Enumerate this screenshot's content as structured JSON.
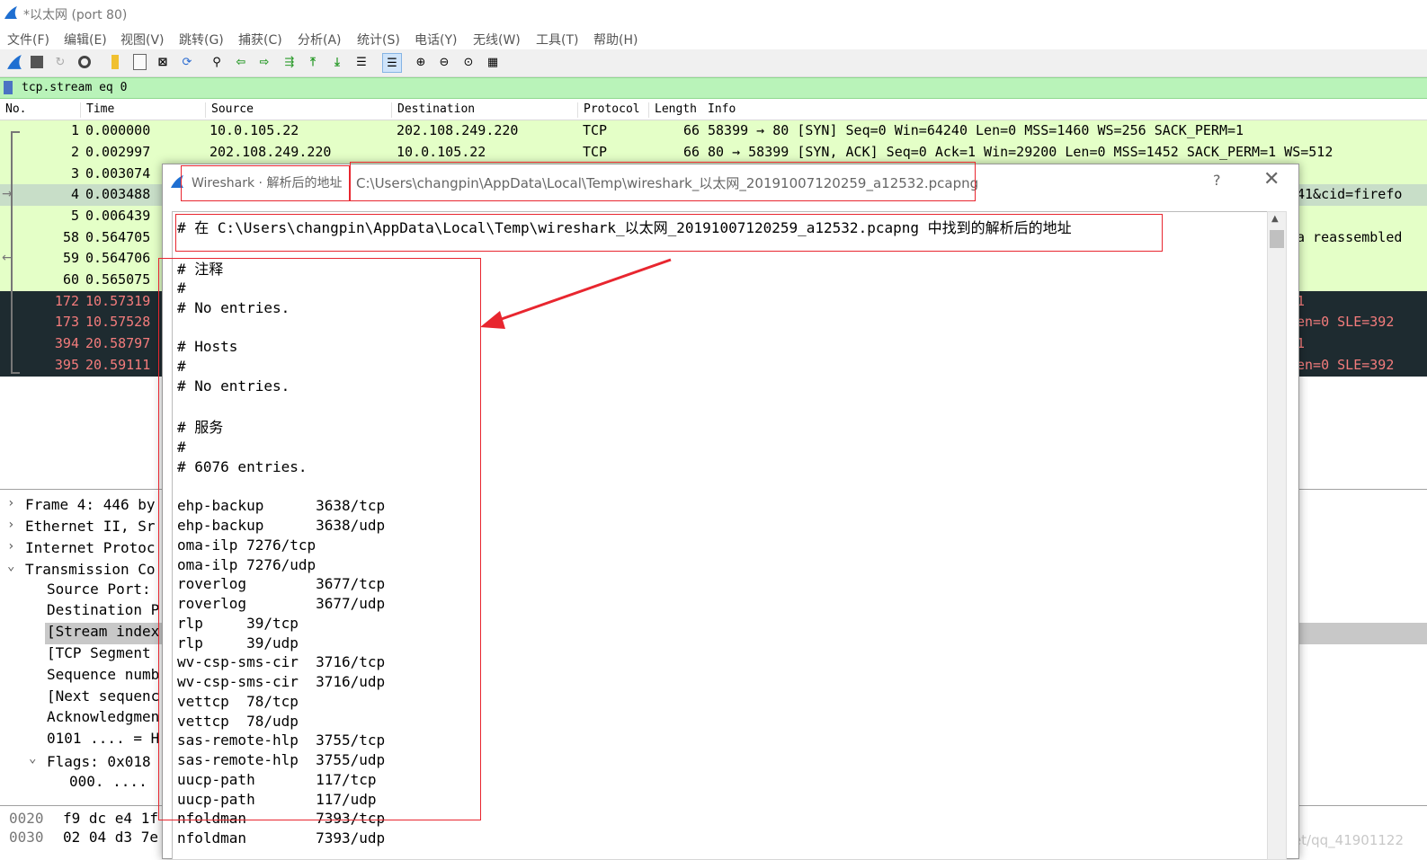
{
  "window": {
    "title": "*以太网 (port 80)"
  },
  "menu": [
    "文件(F)",
    "编辑(E)",
    "视图(V)",
    "跳转(G)",
    "捕获(C)",
    "分析(A)",
    "统计(S)",
    "电话(Y)",
    "无线(W)",
    "工具(T)",
    "帮助(H)"
  ],
  "toolbar": {
    "icons": [
      "shark-fin-start-icon",
      "stop-square-icon",
      "restart-icon",
      "capture-options-icon",
      "open-folder-icon",
      "save-file-icon",
      "close-file-icon",
      "reload-icon",
      "find-packet-icon",
      "go-back-icon",
      "go-forward-icon",
      "go-to-packet-icon",
      "first-packet-icon",
      "last-packet-icon",
      "autoscroll-icon",
      "colorize-icon",
      "zoom-in-icon",
      "zoom-out-icon",
      "normal-size-icon",
      "resize-columns-icon"
    ]
  },
  "filter": {
    "value": "tcp.stream eq 0"
  },
  "packet_list": {
    "columns": [
      "No.",
      "Time",
      "Source",
      "Destination",
      "Protocol",
      "Length",
      "Info"
    ],
    "rows": [
      {
        "no": "1",
        "time": "0.000000",
        "src": "10.0.105.22",
        "dst": "202.108.249.220",
        "proto": "TCP",
        "len": "66",
        "info": "58399 → 80 [SYN] Seq=0 Win=64240 Len=0 MSS=1460 WS=256 SACK_PERM=1",
        "style": "green"
      },
      {
        "no": "2",
        "time": "0.002997",
        "src": "202.108.249.220",
        "dst": "10.0.105.22",
        "proto": "TCP",
        "len": "66",
        "info": "80 → 58399 [SYN, ACK] Seq=0 Ack=1 Win=29200 Len=0 MSS=1452 SACK_PERM=1 WS=512",
        "style": "green"
      },
      {
        "no": "3",
        "time": "0.003074",
        "info_tail": "",
        "style": "green"
      },
      {
        "no": "4",
        "time": "0.003488",
        "info_tail": "41&cid=firefo",
        "style": "sel"
      },
      {
        "no": "5",
        "time": "0.006439",
        "info_tail": "",
        "style": "green"
      },
      {
        "no": "58",
        "time": "0.564705",
        "info_tail": "a reassembled",
        "style": "green"
      },
      {
        "no": "59",
        "time": "0.564706",
        "info_tail": "",
        "style": "green"
      },
      {
        "no": "60",
        "time": "0.565075",
        "info_tail": "",
        "style": "green"
      },
      {
        "no": "172",
        "time": "10.57319",
        "info_tail": "1",
        "style": "dark"
      },
      {
        "no": "173",
        "time": "10.57528",
        "info_tail": "en=0 SLE=392",
        "style": "dark"
      },
      {
        "no": "394",
        "time": "20.58797",
        "info_tail": "1",
        "style": "dark"
      },
      {
        "no": "395",
        "time": "20.59111",
        "info_tail": "en=0 SLE=392",
        "style": "dark"
      }
    ]
  },
  "details": {
    "rows": [
      {
        "text": "Frame 4: 446 by",
        "expander": "›"
      },
      {
        "text": "Ethernet II, Sr",
        "expander": "›"
      },
      {
        "text": "Internet Protoc",
        "expander": "›"
      },
      {
        "text": "Transmission Co",
        "expander": "⌄"
      },
      {
        "text": "Source Port:"
      },
      {
        "text": "Destination P"
      },
      {
        "text": "[Stream index"
      },
      {
        "text": "[TCP Segment"
      },
      {
        "text": "Sequence numb"
      },
      {
        "text": "[Next sequenc"
      },
      {
        "text": "Acknowledgmen"
      },
      {
        "text": "0101 .... = H"
      },
      {
        "text": "Flags: 0x018",
        "expander": "⌄"
      },
      {
        "text": "000. ...."
      },
      {
        "text": ".... ..."
      }
    ]
  },
  "bytes": [
    {
      "offset": "0020",
      "hex": "f9 dc e4 1f"
    },
    {
      "offset": "0030",
      "hex": "02 04 d3 7e"
    }
  ],
  "watermark": "https://blog.csdn.net/qq_41901122",
  "dialog": {
    "title": "Wireshark · 解析后的地址",
    "path": "C:\\Users\\changpin\\AppData\\Local\\Temp\\wireshark_以太网_20191007120259_a12532.pcapng",
    "help": "?",
    "close": "✕",
    "lines": [
      "# 在 C:\\Users\\changpin\\AppData\\Local\\Temp\\wireshark_以太网_20191007120259_a12532.pcapng 中找到的解析后的地址",
      "",
      "# 注释",
      "#",
      "# No entries.",
      "",
      "# Hosts",
      "#",
      "# No entries.",
      "",
      "# 服务",
      "#",
      "# 6076 entries.",
      "",
      "ehp-backup      3638/tcp",
      "ehp-backup      3638/udp",
      "oma-ilp 7276/tcp",
      "oma-ilp 7276/udp",
      "roverlog        3677/tcp",
      "roverlog        3677/udp",
      "rlp     39/tcp",
      "rlp     39/udp",
      "wv-csp-sms-cir  3716/tcp",
      "wv-csp-sms-cir  3716/udp",
      "vettcp  78/tcp",
      "vettcp  78/udp",
      "sas-remote-hlp  3755/tcp",
      "sas-remote-hlp  3755/udp",
      "uucp-path       117/tcp",
      "uucp-path       117/udp",
      "nfoldman        7393/tcp",
      "nfoldman        7393/udp"
    ]
  }
}
